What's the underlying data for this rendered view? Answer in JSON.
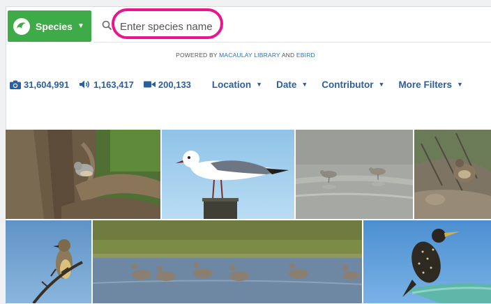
{
  "search": {
    "species_label": "Species",
    "placeholder": "Enter species name"
  },
  "powered_by": {
    "prefix": "POWERED BY",
    "link1": "MACAULAY LIBRARY",
    "joiner": "AND",
    "link2": "EBIRD"
  },
  "stats": {
    "photos": "31,604,991",
    "audio": "1,163,417",
    "video": "200,133"
  },
  "filters": {
    "location": "Location",
    "date": "Date",
    "contributor": "Contributor",
    "more": "More Filters"
  },
  "colors": {
    "brand_green": "#3eaa48",
    "link_blue": "#2b5f9e",
    "highlight_pink": "#e8168d"
  },
  "photos_row1": [
    "titmouse-on-tree",
    "laughing-gull-on-post",
    "shorebirds-in-water",
    "quail-on-ground"
  ],
  "photos_row2": [
    "flycatcher-on-branch",
    "geese-on-water",
    "starling-on-rail"
  ]
}
